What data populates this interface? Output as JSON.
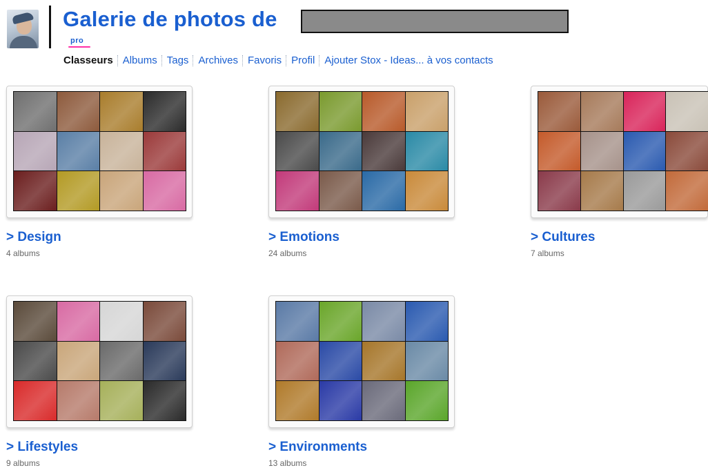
{
  "header": {
    "title": "Galerie de photos de",
    "badge": "pro"
  },
  "nav": {
    "items": [
      {
        "label": "Classeurs",
        "active": true
      },
      {
        "label": "Albums"
      },
      {
        "label": "Tags"
      },
      {
        "label": "Archives"
      },
      {
        "label": "Favoris"
      },
      {
        "label": "Profil"
      },
      {
        "label": "Ajouter Stox - Ideas... à vos contacts"
      }
    ]
  },
  "sets": [
    {
      "title": "> Design",
      "count": "4 albums",
      "colors": [
        "#6f6f6f",
        "#8d5a3c",
        "#a97d2c",
        "#2b2b2b",
        "#b7a6b6",
        "#5a7fa6",
        "#c8b39a",
        "#9b3a3a",
        "#6b1e1e",
        "#b39a24",
        "#c9a57a",
        "#d86aa3"
      ]
    },
    {
      "title": "> Emotions",
      "count": "24 albums",
      "colors": [
        "#8a6a2e",
        "#7a9a2e",
        "#b85a2a",
        "#c9a06a",
        "#4a4a4a",
        "#3a6a8a",
        "#4a3a3a",
        "#2a8aa6",
        "#c23a7a",
        "#7a5a4a",
        "#2a6aa6",
        "#c98a3a"
      ]
    },
    {
      "title": "> Cultures",
      "count": "7 albums",
      "colors": [
        "#9a5a3a",
        "#a67a5a",
        "#d9245a",
        "#c9c2b6",
        "#c45a2a",
        "#a6928a",
        "#2a5ab0",
        "#8a4a3a",
        "#8a3a4a",
        "#a67a4a",
        "#9a9a9a",
        "#c26a3a"
      ]
    },
    {
      "title": "> Lifestyles",
      "count": "9 albums",
      "colors": [
        "#5a4a3a",
        "#d86aa3",
        "#d6d6d6",
        "#7a4a3a",
        "#4a4a4a",
        "#c9a67a",
        "#6a6a6a",
        "#2a3a5a",
        "#d92a2a",
        "#b67a6a",
        "#a6b05a",
        "#2a2a2a"
      ]
    },
    {
      "title": "> Environments",
      "count": "13 albums",
      "colors": [
        "#5a7aa6",
        "#6aa62a",
        "#7a8aa6",
        "#2a5ab0",
        "#b06a5a",
        "#2a4aa6",
        "#a6762a",
        "#6a8aa6",
        "#b07a2a",
        "#2a3aa6",
        "#6a6a7a",
        "#5aa62a"
      ]
    }
  ]
}
